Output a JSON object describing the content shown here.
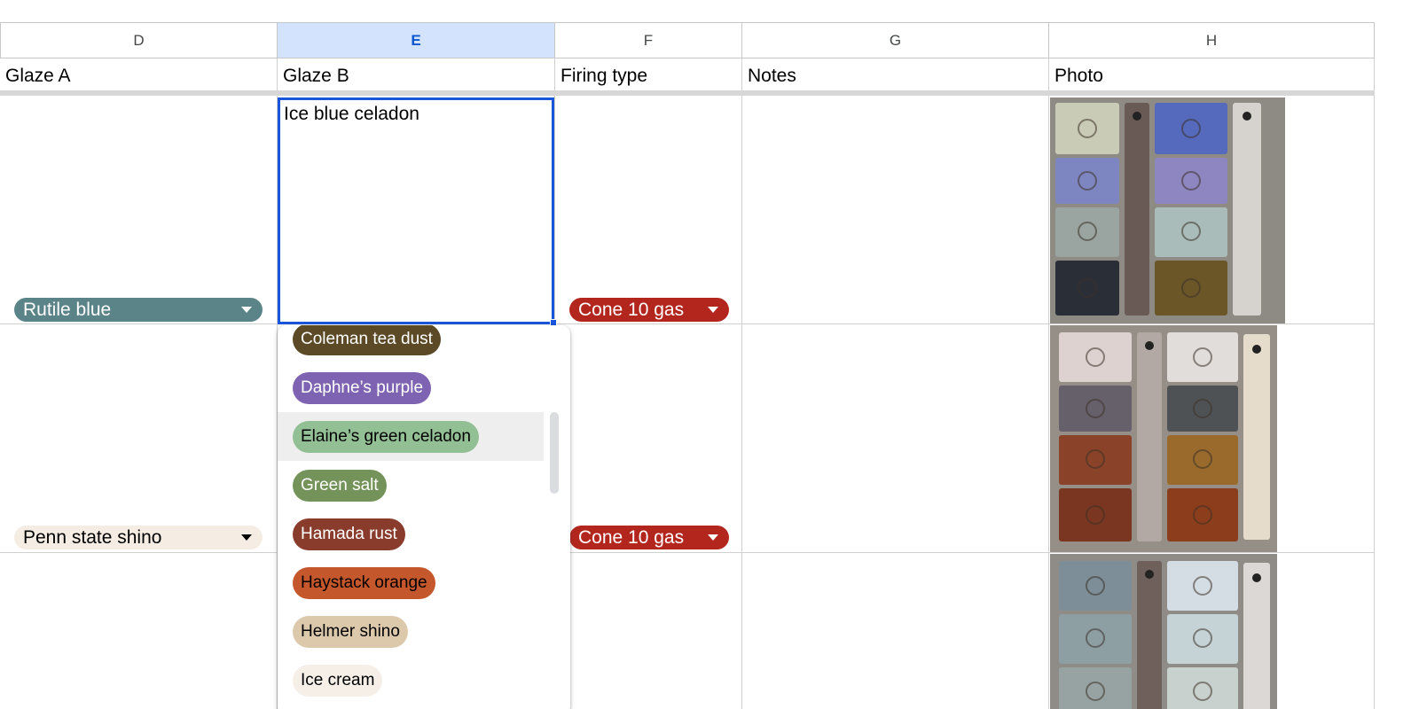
{
  "columns": {
    "d": "D",
    "e": "E",
    "f": "F",
    "g": "G",
    "h": "H"
  },
  "headers": {
    "glaze_a": "Glaze A",
    "glaze_b": "Glaze B",
    "firing_type": "Firing type",
    "notes": "Notes",
    "photo": "Photo"
  },
  "rows": [
    {
      "glaze_a": "Rutile blue",
      "glaze_b": "Ice blue celadon",
      "firing_type": "Cone 10 gas"
    },
    {
      "glaze_a": "Penn state shino",
      "firing_type": "Cone 10 gas"
    }
  ],
  "dropdown": {
    "options": [
      "Coleman tea dust",
      "Daphne’s purple",
      "Elaine’s green celadon",
      "Green salt",
      "Hamada rust",
      "Haystack orange",
      "Helmer shino",
      "Ice cream"
    ],
    "hovered": "Elaine’s green celadon"
  },
  "colors": {
    "rutile_blue": "#5b8489",
    "penn_state_shino": "#f5ede4",
    "cone_10_gas": "#b3261e",
    "coleman_tea_dust": "#5c4a26",
    "daphnes_purple": "#7d63b1",
    "elaines_green_celadon": "#93bf95",
    "green_salt": "#74935a",
    "hamada_rust": "#8a3c2c",
    "haystack_orange": "#c4572c",
    "helmer_shino": "#dcc9ac",
    "ice_cream": "#f5efe8",
    "selection_blue": "#1a56db"
  }
}
